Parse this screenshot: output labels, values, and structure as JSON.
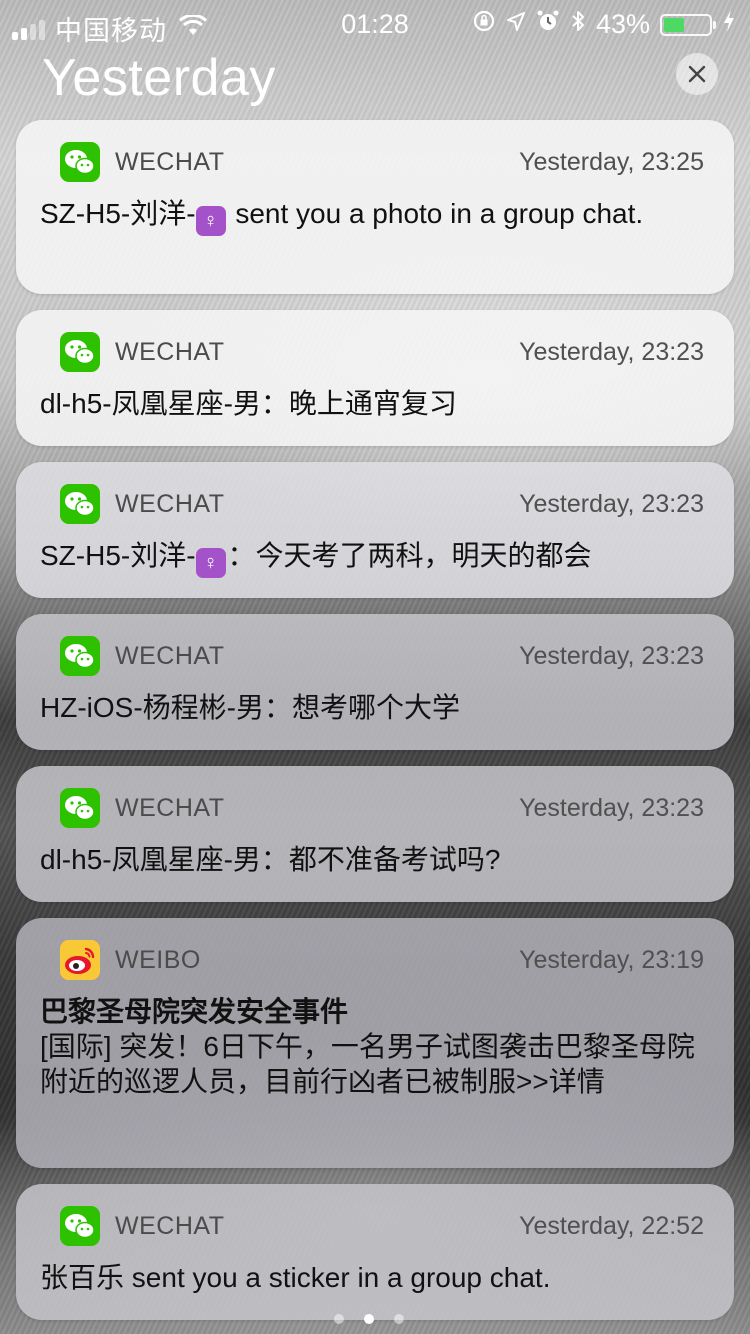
{
  "status_bar": {
    "carrier": "中国移动",
    "time": "01:28",
    "battery_percent": "43%"
  },
  "section": {
    "title": "Yesterday",
    "clear_icon": "close-icon"
  },
  "notifications": [
    {
      "app": "WECHAT",
      "icon": "wechat-icon",
      "time": "Yesterday, 23:25",
      "sender": "SZ-H5-刘洋-",
      "has_emoji": true,
      "message": " sent you a photo in a group chat."
    },
    {
      "app": "WECHAT",
      "icon": "wechat-icon",
      "time": "Yesterday, 23:23",
      "sender": "dl-h5-凤凰星座-男",
      "has_emoji": false,
      "message": "：晚上通宵复习"
    },
    {
      "app": "WECHAT",
      "icon": "wechat-icon",
      "time": "Yesterday, 23:23",
      "sender": "SZ-H5-刘洋-",
      "has_emoji": true,
      "message": "：今天考了两科，明天的都会"
    },
    {
      "app": "WECHAT",
      "icon": "wechat-icon",
      "time": "Yesterday, 23:23",
      "sender": "HZ-iOS-杨程彬-男",
      "has_emoji": false,
      "message": "：想考哪个大学"
    },
    {
      "app": "WECHAT",
      "icon": "wechat-icon",
      "time": "Yesterday, 23:23",
      "sender": "dl-h5-凤凰星座-男",
      "has_emoji": false,
      "message": "：都不准备考试吗?"
    },
    {
      "app": "WEIBO",
      "icon": "weibo-icon",
      "time": "Yesterday, 23:19",
      "title": "巴黎圣母院突发安全事件",
      "message": "[国际] 突发！6日下午，一名男子试图袭击巴黎圣母院附近的巡逻人员，目前行凶者已被制服>>详情"
    },
    {
      "app": "WECHAT",
      "icon": "wechat-icon",
      "time": "Yesterday, 22:52",
      "sender": "张百乐",
      "has_emoji": false,
      "message": " sent you a sticker in a group chat."
    }
  ],
  "colors": {
    "wechat_green": "#2dc100",
    "weibo_red": "#e6162d",
    "battery_green": "#4cd964"
  }
}
